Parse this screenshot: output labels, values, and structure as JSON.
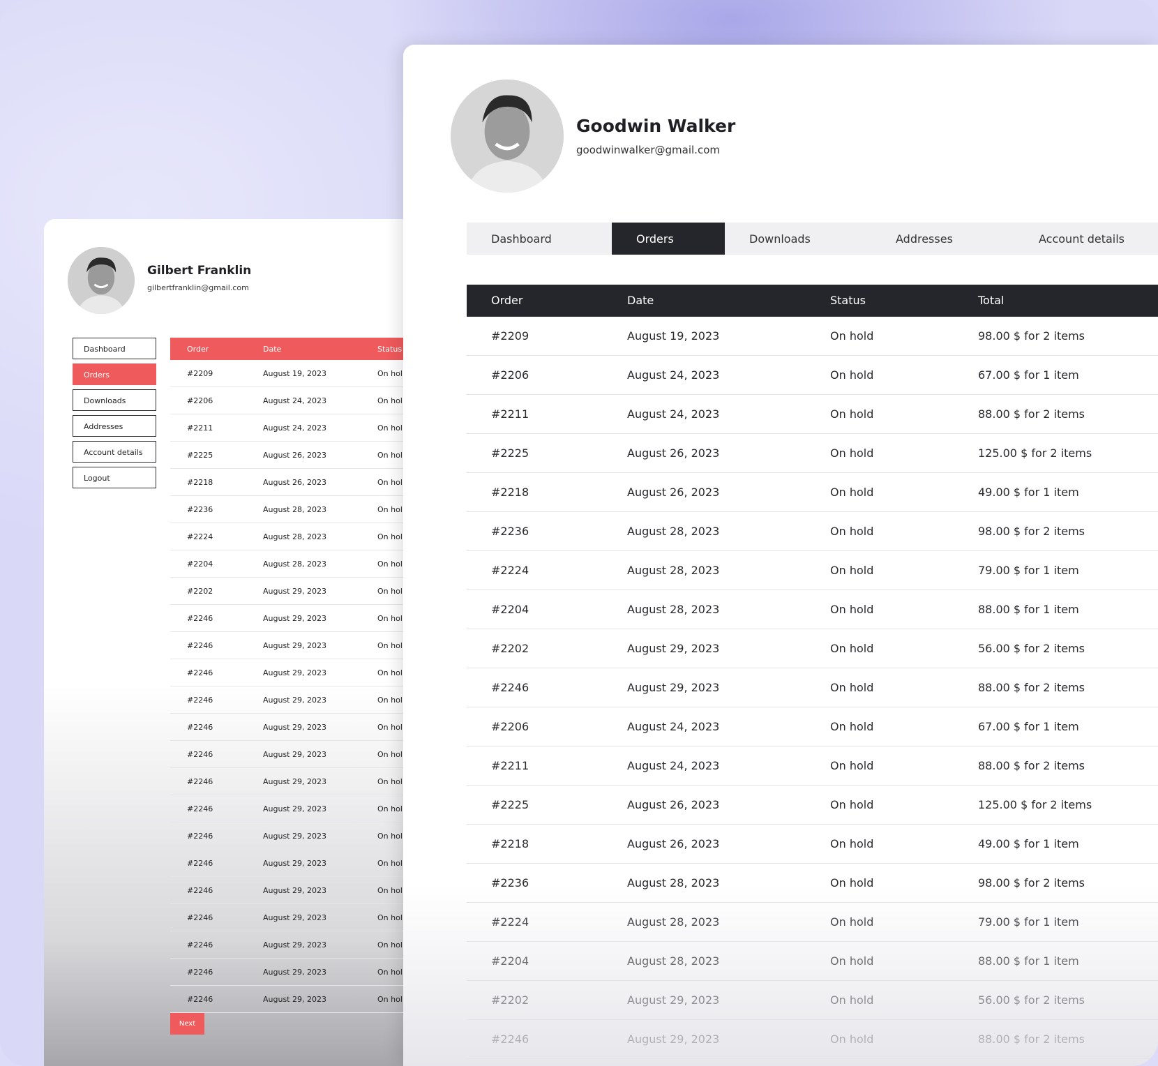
{
  "back_window": {
    "profile": {
      "name": "Gilbert Franklin",
      "email": "gilbertfranklin@gmail.com"
    },
    "nav": [
      "Dashboard",
      "Orders",
      "Downloads",
      "Addresses",
      "Account details",
      "Logout"
    ],
    "active_nav": "Orders",
    "table": {
      "headers": [
        "Order",
        "Date",
        "Status"
      ],
      "rows": [
        [
          "#2209",
          "August 19, 2023",
          "On hol"
        ],
        [
          "#2206",
          "August 24, 2023",
          "On hol"
        ],
        [
          "#2211",
          "August 24, 2023",
          "On hol"
        ],
        [
          "#2225",
          "August 26, 2023",
          "On hol"
        ],
        [
          "#2218",
          "August 26, 2023",
          "On hol"
        ],
        [
          "#2236",
          "August 28, 2023",
          "On hol"
        ],
        [
          "#2224",
          "August 28, 2023",
          "On hol"
        ],
        [
          "#2204",
          "August 28, 2023",
          "On hol"
        ],
        [
          "#2202",
          "August 29, 2023",
          "On hol"
        ],
        [
          "#2246",
          "August 29, 2023",
          "On hol"
        ],
        [
          "#2246",
          "August 29, 2023",
          "On hol"
        ],
        [
          "#2246",
          "August 29, 2023",
          "On hol"
        ],
        [
          "#2246",
          "August 29, 2023",
          "On hol"
        ],
        [
          "#2246",
          "August 29, 2023",
          "On hol"
        ],
        [
          "#2246",
          "August 29, 2023",
          "On hol"
        ],
        [
          "#2246",
          "August 29, 2023",
          "On hol"
        ],
        [
          "#2246",
          "August 29, 2023",
          "On hol"
        ],
        [
          "#2246",
          "August 29, 2023",
          "On hol"
        ],
        [
          "#2246",
          "August 29, 2023",
          "On hol"
        ],
        [
          "#2246",
          "August 29, 2023",
          "On hol"
        ],
        [
          "#2246",
          "August 29, 2023",
          "On hol"
        ],
        [
          "#2246",
          "August 29, 2023",
          "On hol"
        ],
        [
          "#2246",
          "August 29, 2023",
          "On hol"
        ],
        [
          "#2246",
          "August 29, 2023",
          "On hol"
        ]
      ]
    },
    "next_label": "Next",
    "accent_color": "#ef5a5c"
  },
  "front_window": {
    "profile": {
      "name": "Goodwin Walker",
      "email": "goodwinwalker@gmail.com"
    },
    "tabs": [
      "Dashboard",
      "Orders",
      "Downloads",
      "Addresses",
      "Account details"
    ],
    "active_tab": "Orders",
    "table": {
      "headers": [
        "Order",
        "Date",
        "Status",
        "Total"
      ],
      "rows": [
        [
          "#2209",
          "August 19, 2023",
          "On hold",
          "98.00 $ for 2 items"
        ],
        [
          "#2206",
          "August 24, 2023",
          "On hold",
          "67.00 $ for 1 item"
        ],
        [
          "#2211",
          "August 24, 2023",
          "On hold",
          "88.00 $ for 2 items"
        ],
        [
          "#2225",
          "August 26, 2023",
          "On hold",
          "125.00 $ for 2 items"
        ],
        [
          "#2218",
          "August 26, 2023",
          "On hold",
          "49.00 $ for 1 item"
        ],
        [
          "#2236",
          "August 28, 2023",
          "On hold",
          "98.00 $ for 2 items"
        ],
        [
          "#2224",
          "August 28, 2023",
          "On hold",
          "79.00 $ for 1 item"
        ],
        [
          "#2204",
          "August 28, 2023",
          "On hold",
          "88.00 $ for 1 item"
        ],
        [
          "#2202",
          "August 29, 2023",
          "On hold",
          "56.00 $ for 2 items"
        ],
        [
          "#2246",
          "August 29, 2023",
          "On hold",
          "88.00 $ for 2 items"
        ],
        [
          "#2206",
          "August 24, 2023",
          "On hold",
          "67.00 $ for 1 item"
        ],
        [
          "#2211",
          "August 24, 2023",
          "On hold",
          "88.00 $ for 2 items"
        ],
        [
          "#2225",
          "August 26, 2023",
          "On hold",
          "125.00 $ for 2 items"
        ],
        [
          "#2218",
          "August 26, 2023",
          "On hold",
          "49.00 $ for 1 item"
        ],
        [
          "#2236",
          "August 28, 2023",
          "On hold",
          "98.00 $ for 2 items"
        ],
        [
          "#2224",
          "August 28, 2023",
          "On hold",
          "79.00 $ for 1 item"
        ],
        [
          "#2204",
          "August 28, 2023",
          "On hold",
          "88.00 $ for 1 item"
        ],
        [
          "#2202",
          "August 29, 2023",
          "On hold",
          "56.00 $ for 2 items"
        ],
        [
          "#2246",
          "August 29, 2023",
          "On hold",
          "88.00 $ for 2 items"
        ]
      ]
    },
    "accent_color": "#25262b"
  },
  "icons": [
    "avatar-photo"
  ]
}
